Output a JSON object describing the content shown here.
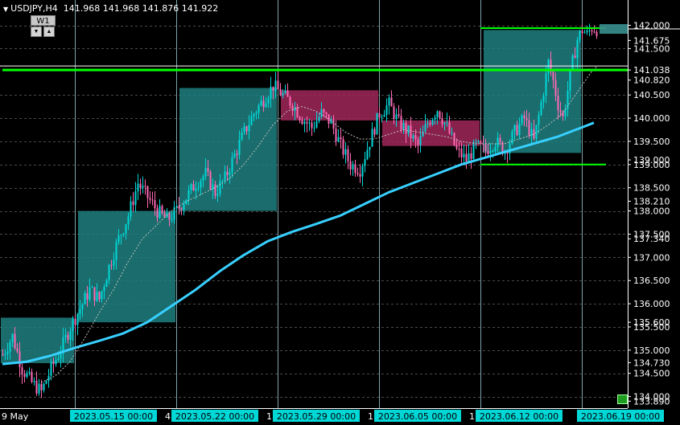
{
  "header": {
    "symbol": "USDJPY,H4",
    "open": "141.968",
    "high": "141.968",
    "low": "141.876",
    "close": "141.922"
  },
  "timeframe": {
    "label": "W1"
  },
  "chart_data": {
    "type": "candlestick",
    "symbol": "USDJPY",
    "timeframe": "H4",
    "ylim": [
      133.75,
      142.2
    ],
    "y_ticks": [
      "142.000",
      "141.500",
      "140.500",
      "140.000",
      "139.500",
      "139.000",
      "138.500",
      "138.000",
      "137.500",
      "137.000",
      "136.500",
      "136.000",
      "135.500",
      "135.000",
      "134.500",
      "134.000"
    ],
    "y_levels": [
      "141.675",
      "141.038",
      "140.820",
      "138.210",
      "134.730"
    ],
    "y_partial": [
      {
        "value": 139.1,
        "text": "139.000"
      },
      {
        "value": 137.4,
        "text": "137.340"
      },
      {
        "value": 135.6,
        "text": "135.600"
      },
      {
        "value": 133.9,
        "text": "133.890"
      }
    ],
    "price_tag": "141.922",
    "x_labels": [
      {
        "text": "2023.05.15 00:00",
        "bar": 30
      },
      {
        "text": "2023.05.22 00:00",
        "bar": 72
      },
      {
        "text": "2023.05.29 00:00",
        "bar": 114
      },
      {
        "text": "2023.06.05 00:00",
        "bar": 156
      },
      {
        "text": "2023.06.12 00:00",
        "bar": 198
      },
      {
        "text": "2023.06.19 00:00",
        "bar": 240
      }
    ],
    "x_partial": [
      "9 May",
      "4",
      "1",
      "1",
      "1"
    ],
    "weekly_boxes": [
      {
        "start_bar": 0,
        "end_bar": 29,
        "open": 134.72,
        "close": 135.7,
        "high": 135.7,
        "low": 133.8
      },
      {
        "start_bar": 32,
        "end_bar": 71,
        "open": 135.6,
        "close": 138.0,
        "high": 138.75,
        "low": 135.3
      },
      {
        "start_bar": 74,
        "end_bar": 113,
        "open": 138.0,
        "close": 140.65,
        "high": 140.8,
        "low": 137.7
      },
      {
        "start_bar": 116,
        "end_bar": 155,
        "open": 140.6,
        "close": 139.95,
        "high": 140.8,
        "low": 138.6
      },
      {
        "start_bar": 158,
        "end_bar": 197,
        "open": 139.95,
        "close": 139.4,
        "high": 140.5,
        "low": 138.75
      },
      {
        "start_bar": 200,
        "end_bar": 239,
        "open": 139.25,
        "close": 141.9,
        "high": 142.0,
        "low": 139.0
      }
    ],
    "levels": [
      {
        "value": 141.038,
        "from_bar": 0,
        "to_bar": 270
      },
      {
        "value": 141.94,
        "from_bar": 198,
        "to_bar": 250
      },
      {
        "value": 139.0,
        "from_bar": 198,
        "to_bar": 250
      }
    ],
    "close_path": [
      [
        0,
        134.9
      ],
      [
        4,
        135.3
      ],
      [
        8,
        134.6
      ],
      [
        12,
        134.3
      ],
      [
        16,
        134.1
      ],
      [
        20,
        134.6
      ],
      [
        24,
        135.0
      ],
      [
        28,
        135.5
      ],
      [
        32,
        135.9
      ],
      [
        36,
        136.3
      ],
      [
        40,
        136.1
      ],
      [
        44,
        136.8
      ],
      [
        48,
        137.4
      ],
      [
        52,
        137.9
      ],
      [
        56,
        138.6
      ],
      [
        60,
        138.3
      ],
      [
        64,
        138.0
      ],
      [
        68,
        137.8
      ],
      [
        72,
        138.0
      ],
      [
        76,
        138.3
      ],
      [
        80,
        138.6
      ],
      [
        84,
        138.8
      ],
      [
        88,
        138.4
      ],
      [
        92,
        138.7
      ],
      [
        96,
        139.2
      ],
      [
        100,
        139.7
      ],
      [
        104,
        140.1
      ],
      [
        108,
        140.4
      ],
      [
        112,
        140.7
      ],
      [
        116,
        140.5
      ],
      [
        120,
        140.3
      ],
      [
        124,
        140.0
      ],
      [
        128,
        139.8
      ],
      [
        132,
        140.1
      ],
      [
        136,
        139.9
      ],
      [
        140,
        139.4
      ],
      [
        144,
        139.0
      ],
      [
        148,
        138.9
      ],
      [
        152,
        139.5
      ],
      [
        156,
        140.1
      ],
      [
        160,
        140.3
      ],
      [
        164,
        139.9
      ],
      [
        168,
        139.7
      ],
      [
        172,
        139.4
      ],
      [
        176,
        139.9
      ],
      [
        180,
        140.2
      ],
      [
        184,
        139.8
      ],
      [
        188,
        139.3
      ],
      [
        192,
        139.1
      ],
      [
        196,
        139.4
      ],
      [
        200,
        139.3
      ],
      [
        204,
        139.5
      ],
      [
        208,
        139.3
      ],
      [
        212,
        139.7
      ],
      [
        216,
        140.0
      ],
      [
        220,
        139.5
      ],
      [
        224,
        140.6
      ],
      [
        226,
        141.2
      ],
      [
        228,
        140.8
      ],
      [
        230,
        140.3
      ],
      [
        232,
        140.0
      ],
      [
        234,
        140.6
      ],
      [
        236,
        141.2
      ],
      [
        238,
        141.7
      ],
      [
        240,
        141.9
      ],
      [
        242,
        141.8
      ],
      [
        244,
        141.95
      ],
      [
        246,
        141.92
      ]
    ],
    "ma_slow": [
      [
        0,
        134.7
      ],
      [
        10,
        134.75
      ],
      [
        20,
        134.88
      ],
      [
        30,
        135.05
      ],
      [
        40,
        135.2
      ],
      [
        50,
        135.36
      ],
      [
        60,
        135.6
      ],
      [
        70,
        135.95
      ],
      [
        80,
        136.3
      ],
      [
        90,
        136.7
      ],
      [
        100,
        137.05
      ],
      [
        110,
        137.35
      ],
      [
        120,
        137.55
      ],
      [
        130,
        137.72
      ],
      [
        140,
        137.9
      ],
      [
        150,
        138.15
      ],
      [
        160,
        138.4
      ],
      [
        170,
        138.6
      ],
      [
        180,
        138.8
      ],
      [
        190,
        139.0
      ],
      [
        200,
        139.15
      ],
      [
        210,
        139.3
      ],
      [
        220,
        139.45
      ],
      [
        230,
        139.6
      ],
      [
        240,
        139.8
      ],
      [
        245,
        139.9
      ]
    ],
    "ma_fast": [
      [
        16,
        134.3
      ],
      [
        22,
        134.45
      ],
      [
        28,
        134.75
      ],
      [
        34,
        135.25
      ],
      [
        40,
        135.8
      ],
      [
        46,
        136.3
      ],
      [
        52,
        136.9
      ],
      [
        58,
        137.4
      ],
      [
        64,
        137.7
      ],
      [
        70,
        138.0
      ],
      [
        76,
        138.2
      ],
      [
        82,
        138.35
      ],
      [
        88,
        138.5
      ],
      [
        94,
        138.7
      ],
      [
        100,
        139.0
      ],
      [
        106,
        139.4
      ],
      [
        112,
        139.85
      ],
      [
        118,
        140.15
      ],
      [
        124,
        140.25
      ],
      [
        130,
        140.15
      ],
      [
        136,
        139.95
      ],
      [
        142,
        139.7
      ],
      [
        148,
        139.55
      ],
      [
        154,
        139.55
      ],
      [
        160,
        139.65
      ],
      [
        166,
        139.75
      ],
      [
        172,
        139.7
      ],
      [
        178,
        139.65
      ],
      [
        184,
        139.6
      ],
      [
        190,
        139.5
      ],
      [
        196,
        139.45
      ],
      [
        202,
        139.45
      ],
      [
        208,
        139.45
      ],
      [
        214,
        139.55
      ],
      [
        220,
        139.65
      ],
      [
        226,
        139.85
      ],
      [
        232,
        140.1
      ],
      [
        238,
        140.55
      ],
      [
        244,
        141.0
      ],
      [
        246,
        141.1
      ]
    ],
    "colors": {
      "background": "#000000",
      "bull": "#00d7d7",
      "bear": "#ff69b4",
      "bull_box": "#207f7f",
      "bear_box": "#a0285a",
      "ma_slow": "#38d0ff",
      "ma_fast": "#bfbfbf",
      "level": "#00ff00",
      "grid": "#4a4a4a",
      "vgrid": "#9ecfd8",
      "axis_text": "#ffffff",
      "price_tag": "#00d7d7"
    }
  }
}
